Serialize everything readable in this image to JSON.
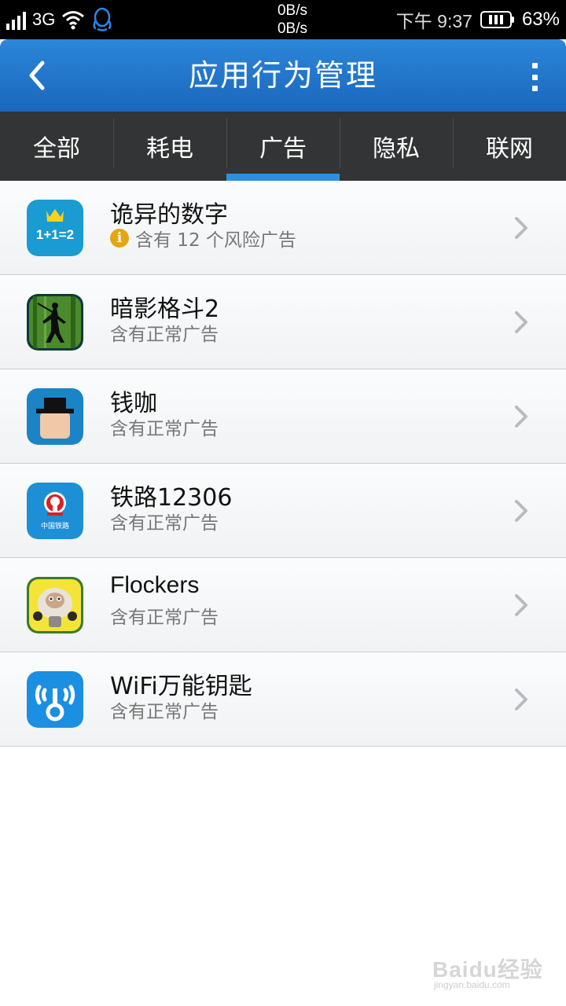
{
  "status_bar": {
    "network": "3G",
    "speed_up": "0B/s",
    "speed_down": "0B/s",
    "time": "下午 9:37",
    "battery": "63%",
    "icons": [
      "signal-icon",
      "wifi-icon",
      "qq-icon",
      "battery-icon"
    ]
  },
  "header": {
    "title": "应用行为管理",
    "back_icon": "back-chevron-icon",
    "menu_icon": "more-vertical-icon"
  },
  "tabs": [
    {
      "label": "全部",
      "active": false
    },
    {
      "label": "耗电",
      "active": false
    },
    {
      "label": "广告",
      "active": true
    },
    {
      "label": "隐私",
      "active": false
    },
    {
      "label": "联网",
      "active": false
    }
  ],
  "apps": [
    {
      "name": "诡异的数字",
      "desc": "含有 12 个风险广告",
      "warning": true,
      "icon": "math-game-icon"
    },
    {
      "name": "暗影格斗2",
      "desc": "含有正常广告",
      "warning": false,
      "icon": "shadow-fight-icon"
    },
    {
      "name": "钱咖",
      "desc": "含有正常广告",
      "warning": false,
      "icon": "qianka-icon"
    },
    {
      "name": "铁路12306",
      "desc": "含有正常广告",
      "warning": false,
      "icon": "railway-icon"
    },
    {
      "name": "Flockers",
      "desc": "含有正常广告",
      "warning": false,
      "icon": "flockers-sheep-icon"
    },
    {
      "name": "WiFi万能钥匙",
      "desc": "含有正常广告",
      "warning": false,
      "icon": "wifi-key-icon"
    }
  ],
  "icon_text": {
    "math": "1+1=2",
    "railway": "中国铁路"
  },
  "watermark": {
    "main": "Baidu经验",
    "sub": "jingyan.baidu.com"
  },
  "colors": {
    "header": "#1f74c9",
    "tabs_bg": "#333435",
    "tab_indicator": "#2d8fe2",
    "warning": "#e4a712"
  }
}
